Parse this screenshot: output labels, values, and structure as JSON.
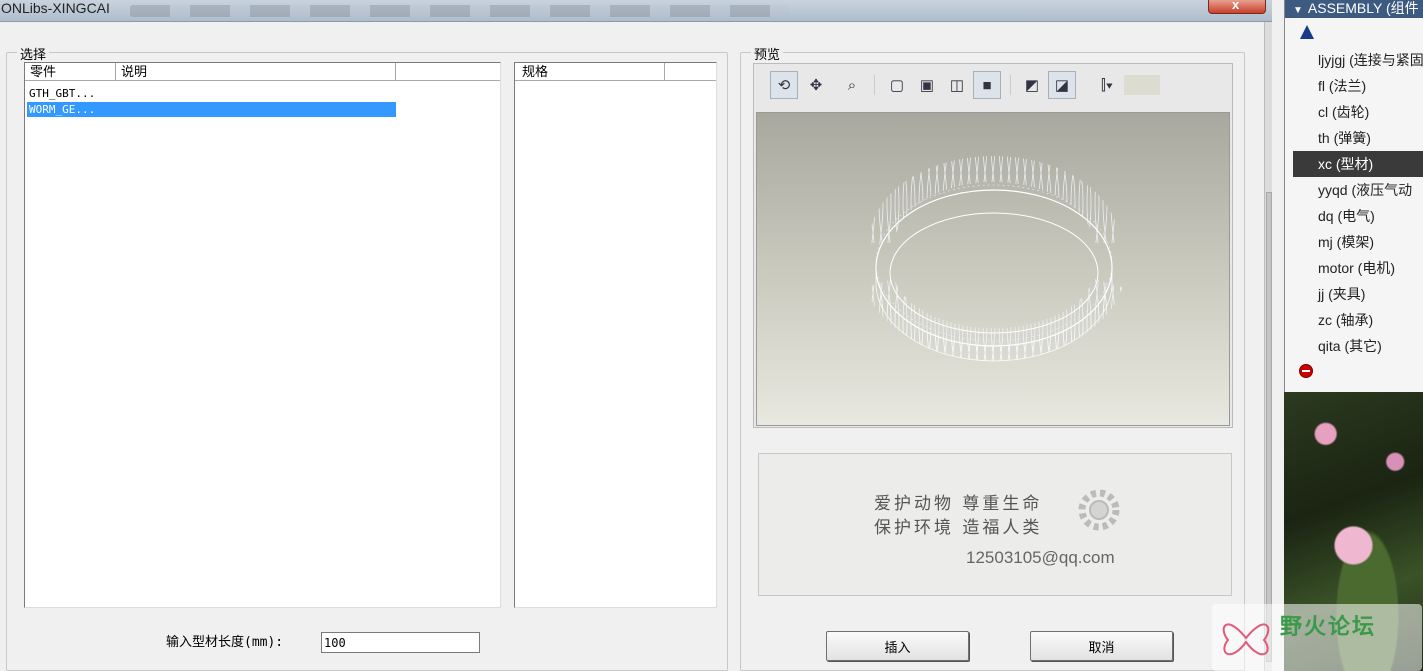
{
  "window": {
    "title": "ONLibs-XINGCAI",
    "close_glyph": "x"
  },
  "select_group": {
    "label": "选择",
    "parts_list": {
      "columns": [
        "零件",
        "说明"
      ],
      "rows": [
        {
          "name": "GTH_GBT..."
        },
        {
          "name": "WORM_GE...",
          "selected": true
        }
      ]
    },
    "spec_list": {
      "columns": [
        "规格"
      ]
    }
  },
  "length": {
    "label": "输入型材长度(mm):",
    "value": "100"
  },
  "preview_group": {
    "label": "预览",
    "toolbar": [
      {
        "icon": "spin-orient-icon",
        "glyph": "⟲",
        "pressed": true
      },
      {
        "icon": "pan-icon",
        "glyph": "✥"
      },
      {
        "icon": "zoom-fit-icon",
        "glyph": "⌕"
      },
      {
        "icon": "wireframe-icon",
        "glyph": "▢"
      },
      {
        "icon": "hidden-line-icon",
        "glyph": "▣"
      },
      {
        "icon": "no-hidden-icon",
        "glyph": "◫"
      },
      {
        "icon": "shaded-icon",
        "glyph": "■",
        "pressed": true
      },
      {
        "icon": "view-saved-icon",
        "glyph": "◩"
      },
      {
        "icon": "view-reorient-icon",
        "glyph": "◪",
        "pressed": true
      },
      {
        "icon": "display-style-dropdown-icon",
        "glyph": "⫿▾"
      }
    ],
    "info": {
      "slogan_line1": "爱护动物  尊重生命",
      "slogan_line2": "保护环境  造福人类",
      "email": "12503105@qq.com"
    }
  },
  "buttons": {
    "insert": "插入",
    "cancel": "取消"
  },
  "assembly_panel": {
    "header": "ASSEMBLY (组件",
    "items": [
      {
        "label": "ljyjgj (连接与紧固"
      },
      {
        "label": "fl (法兰)"
      },
      {
        "label": "cl (齿轮)"
      },
      {
        "label": "th (弹簧)"
      },
      {
        "label": "xc (型材)",
        "selected": true
      },
      {
        "label": "yyqd (液压气动"
      },
      {
        "label": "dq (电气)"
      },
      {
        "label": "mj (模架)"
      },
      {
        "label": "motor (电机)"
      },
      {
        "label": "jj (夹具)"
      },
      {
        "label": "zc (轴承)"
      },
      {
        "label": "qita (其它)"
      }
    ]
  },
  "watermark": {
    "text": "野火论坛"
  }
}
